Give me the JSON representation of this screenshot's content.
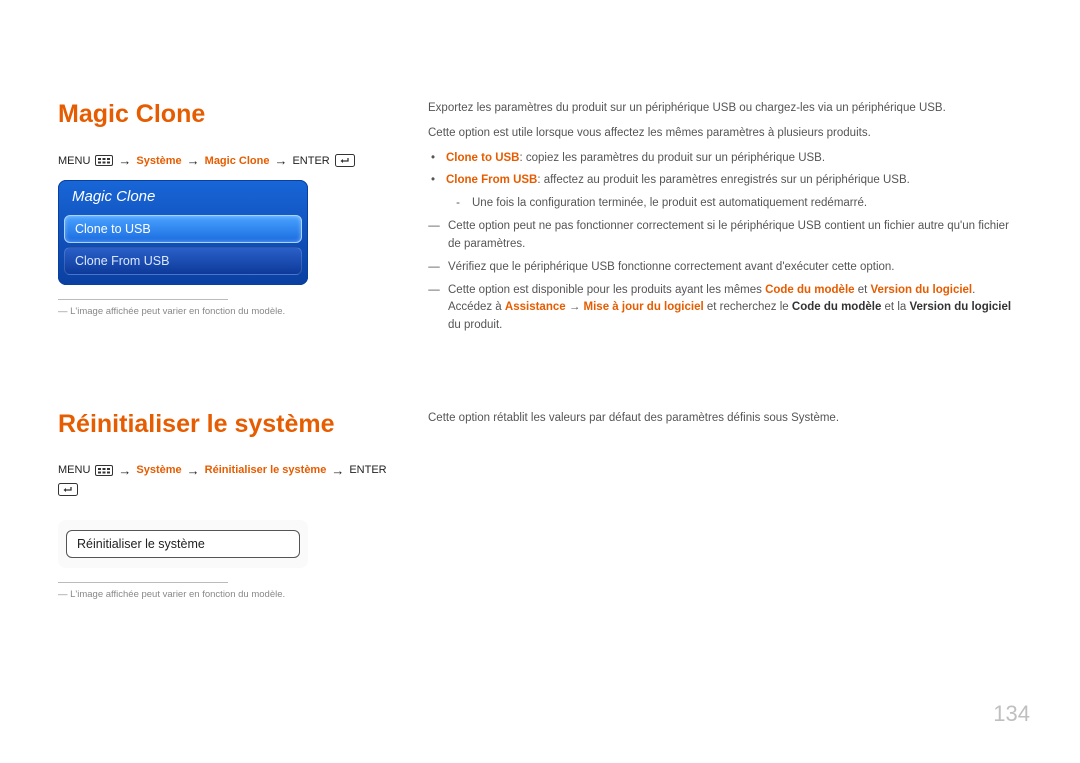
{
  "pageNumber": "134",
  "section1": {
    "heading": "Magic Clone",
    "breadcrumb": {
      "menu": "MENU",
      "path1": "Système",
      "path2": "Magic Clone",
      "enter": "ENTER"
    },
    "osd": {
      "title": "Magic Clone",
      "item_selected": "Clone to USB",
      "item_other": "Clone From USB"
    },
    "footnote": "L'image affichée peut varier en fonction du modèle.",
    "right": {
      "p1": "Exportez les paramètres du produit sur un périphérique USB ou chargez-les via un périphérique USB.",
      "p2": "Cette option est utile lorsque vous affectez les mêmes paramètres à plusieurs produits.",
      "b1_label": "Clone to USB",
      "b1_text": ": copiez les paramètres du produit sur un périphérique USB.",
      "b2_label": "Clone From USB",
      "b2_text": ": affectez au produit les paramètres enregistrés sur un périphérique USB.",
      "sub1": "Une fois la configuration terminée, le produit est automatiquement redémarré.",
      "note1a": "Cette option peut ne pas fonctionner correctement si le périphérique USB contient un fichier autre qu'un fichier de paramètres.",
      "note2": "Vérifiez que le périphérique USB fonctionne correctement avant d'exécuter cette option.",
      "note3_pre": "Cette option est disponible pour les produits ayant les mêmes ",
      "note3_code": "Code du modèle",
      "note3_and": " et ",
      "note3_ver": "Version du logiciel",
      "note3_post": ".",
      "note3b_pre": "Accédez à ",
      "note3b_ass": "Assistance",
      "note3b_arrow": " → ",
      "note3b_maj": "Mise à jour du logiciel",
      "note3b_mid": " et recherchez le ",
      "note3b_code": "Code du modèle",
      "note3b_and": " et la ",
      "note3b_ver": "Version du logiciel",
      "note3b_post": " du produit."
    }
  },
  "section2": {
    "heading": "Réinitialiser le système",
    "breadcrumb": {
      "menu": "MENU",
      "path1": "Système",
      "path2": "Réinitialiser le système",
      "enter": "ENTER"
    },
    "window_item": "Réinitialiser le système",
    "footnote": "L'image affichée peut varier en fonction du modèle.",
    "right": {
      "p1": "Cette option rétablit les valeurs par défaut des paramètres définis sous Système."
    }
  }
}
